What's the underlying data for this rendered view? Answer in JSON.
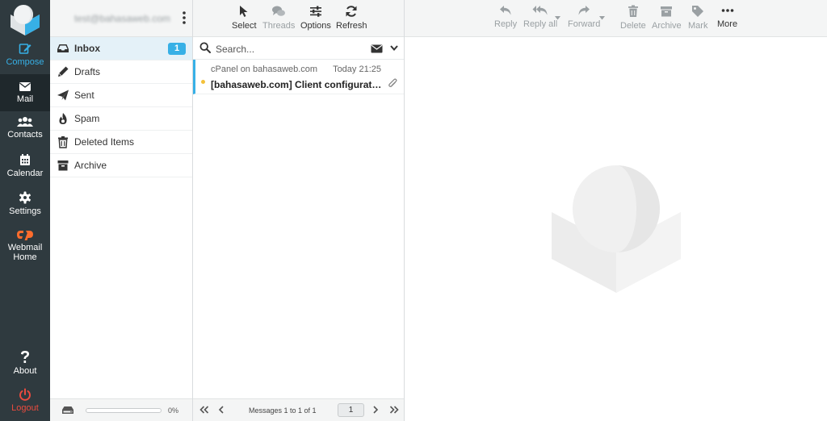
{
  "nav": {
    "items": [
      {
        "label": "Compose",
        "icon": "compose-icon"
      },
      {
        "label": "Mail",
        "icon": "envelope-icon"
      },
      {
        "label": "Contacts",
        "icon": "contacts-icon"
      },
      {
        "label": "Calendar",
        "icon": "calendar-icon"
      },
      {
        "label": "Settings",
        "icon": "gear-icon"
      },
      {
        "label": "Webmail Home",
        "icon": "cpanel-icon"
      },
      {
        "label": "About",
        "icon": "question-icon"
      },
      {
        "label": "Logout",
        "icon": "power-icon"
      }
    ]
  },
  "account": {
    "email": "test@bahasaweb.com"
  },
  "folders": [
    {
      "label": "Inbox",
      "icon": "inbox-icon",
      "unread": "1"
    },
    {
      "label": "Drafts",
      "icon": "pencil-icon"
    },
    {
      "label": "Sent",
      "icon": "paper-plane-icon"
    },
    {
      "label": "Spam",
      "icon": "fire-icon"
    },
    {
      "label": "Deleted Items",
      "icon": "trash-icon"
    },
    {
      "label": "Archive",
      "icon": "archive-icon"
    }
  ],
  "quota": {
    "percent": "0%"
  },
  "list_toolbar": {
    "select": "Select",
    "threads": "Threads",
    "options": "Options",
    "refresh": "Refresh"
  },
  "search": {
    "placeholder": "Search..."
  },
  "messages": [
    {
      "from": "cPanel on bahasaweb.com",
      "date": "Today 21:25",
      "subject": "[bahasaweb.com] Client configuration settings for “test@bahasaweb.com”.",
      "flagged": true,
      "has_attachment": true
    }
  ],
  "pager": {
    "info": "Messages 1 to 1 of 1",
    "page": "1"
  },
  "message_toolbar": {
    "reply": "Reply",
    "reply_all": "Reply all",
    "forward": "Forward",
    "delete": "Delete",
    "archive": "Archive",
    "mark": "Mark",
    "more": "More"
  },
  "colors": {
    "accent": "#37b0e6",
    "rail": "#2f3a3f",
    "logout": "#ea4b3f",
    "webmail": "#ff6c2c"
  }
}
